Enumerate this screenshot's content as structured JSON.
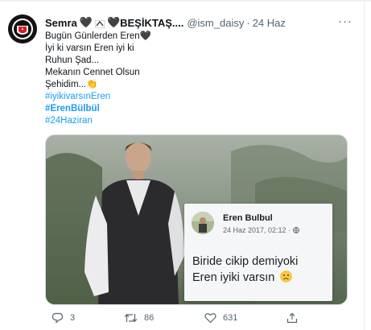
{
  "tweet": {
    "author_name": "Semra",
    "author_suffix": "BEŞİKTAŞ....",
    "handle": "@ism_daisy",
    "separator": "·",
    "time": "24 Haz",
    "more": "···",
    "text_lines": [
      "Bugün Günlerden Eren🖤",
      "İyi ki varsın Eren iyi ki",
      "Ruhun Şad...",
      "Mekanın Cennet Olsun",
      "Şehidim...👏"
    ],
    "hashtags": [
      "#iyikivarsınEren",
      "#ErenBülbül",
      "#24Haziran"
    ]
  },
  "media": {
    "card": {
      "name": "Eren Bulbul",
      "date": "24 Haz 2017, 02:12 · ",
      "text_lines": [
        "Biride cikip demiyoki",
        "Eren iyiki varsın"
      ]
    }
  },
  "actions": {
    "replies": "3",
    "retweets": "86",
    "likes": "631"
  },
  "colors": {
    "accent": "#1d9bf0",
    "secondary_text": "#536471",
    "primary_text": "#0f1419"
  }
}
